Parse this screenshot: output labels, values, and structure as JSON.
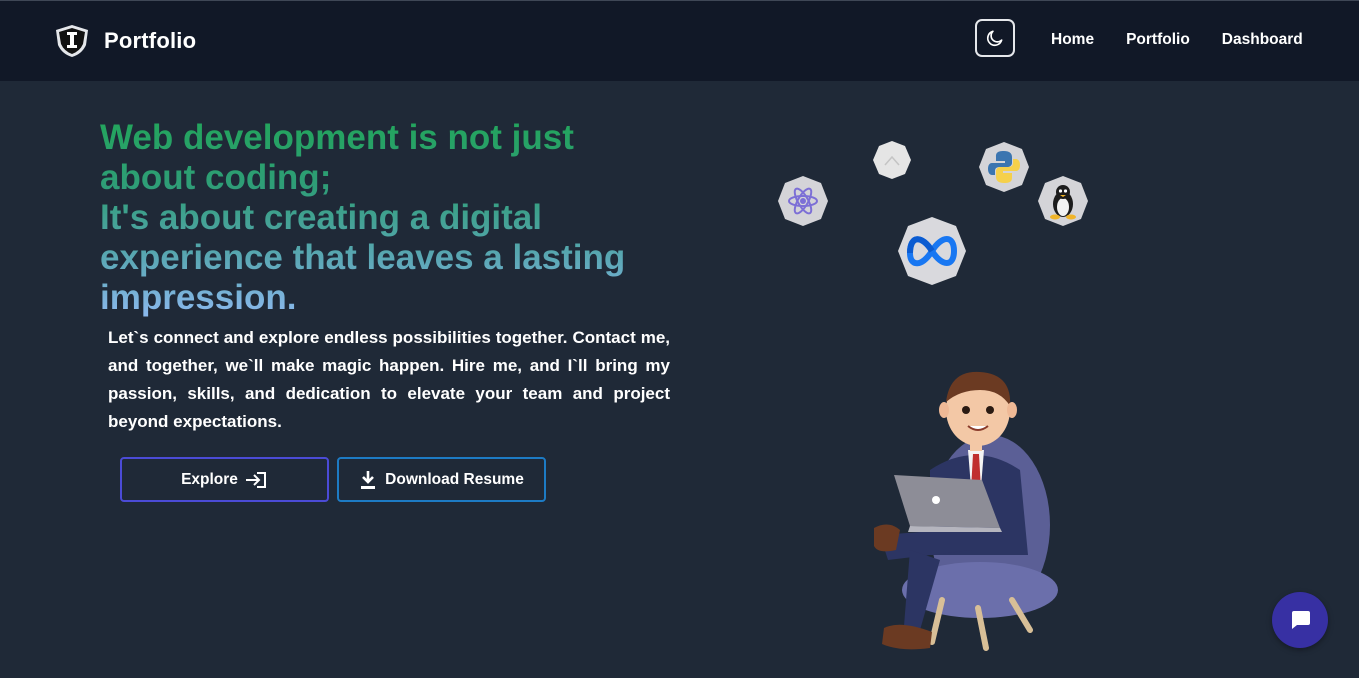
{
  "nav": {
    "brand": "Portfolio",
    "links": [
      "Home",
      "Portfolio",
      "Dashboard"
    ]
  },
  "hero": {
    "headline_lines": [
      "Web development is not just",
      "about coding;",
      "It's about creating a digital",
      "experience that leaves a lasting",
      "impression."
    ],
    "intro": "Let`s connect and explore endless possibilities together. Contact me, and together, we`ll make magic happen. Hire me, and I`ll bring my passion, skills, and dedication to elevate your team and project beyond expectations.",
    "explore_label": "Explore",
    "download_label": "Download Resume"
  },
  "tech_icons": [
    "react-icon",
    "nextjs-icon",
    "meta-icon",
    "python-icon",
    "linux-icon"
  ],
  "colors": {
    "navbar_bg": "#111827",
    "page_bg": "#1f2937",
    "headline_gradient": [
      "#22a55b",
      "#8cb9ef"
    ],
    "explore_border": "#4b4bd6",
    "resume_border": "#1d7bc4",
    "chat_button": "#3730a3"
  }
}
